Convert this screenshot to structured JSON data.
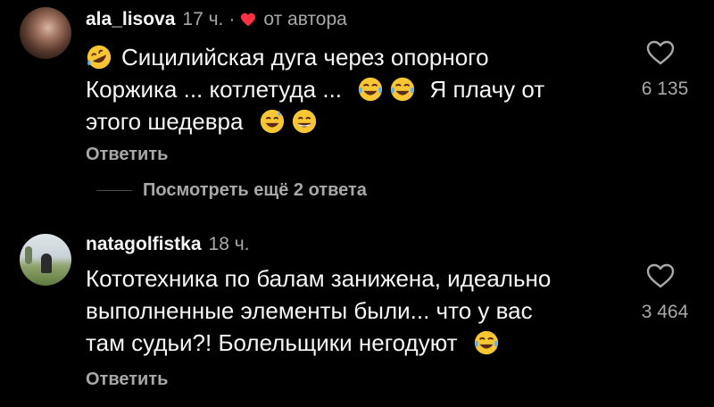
{
  "comments": [
    {
      "username": "ala_lisova",
      "time": "17 ч.",
      "dot": "·",
      "author_badge": "от автора",
      "lines": [
        "Сицилийская дуга через опорного",
        "Коржика ... котлетуда ...",
        "Я плачу от",
        "этого шедевра"
      ],
      "likes": "6 135",
      "reply_label": "Ответить"
    },
    {
      "username": "natagolfistka",
      "time": "18 ч.",
      "lines": [
        "Кототехника по балам занижена, идеально",
        "выполненные элементы были... что у вас",
        "там судьи?! Болельщики негодуют"
      ],
      "likes": "3 464",
      "reply_label": "Ответить"
    }
  ],
  "more_replies": "Посмотреть ещё 2 ответа",
  "colors": {
    "background": "#000000",
    "text": "#f5f5f5",
    "secondary": "#a8a8a8",
    "heart_red": "#ff3040"
  },
  "icons": [
    "rofl-emoji-icon",
    "joy-emoji-icon",
    "sweat-smile-emoji-icon",
    "grin-emoji-icon",
    "heart-icon",
    "heart-outline-icon"
  ]
}
